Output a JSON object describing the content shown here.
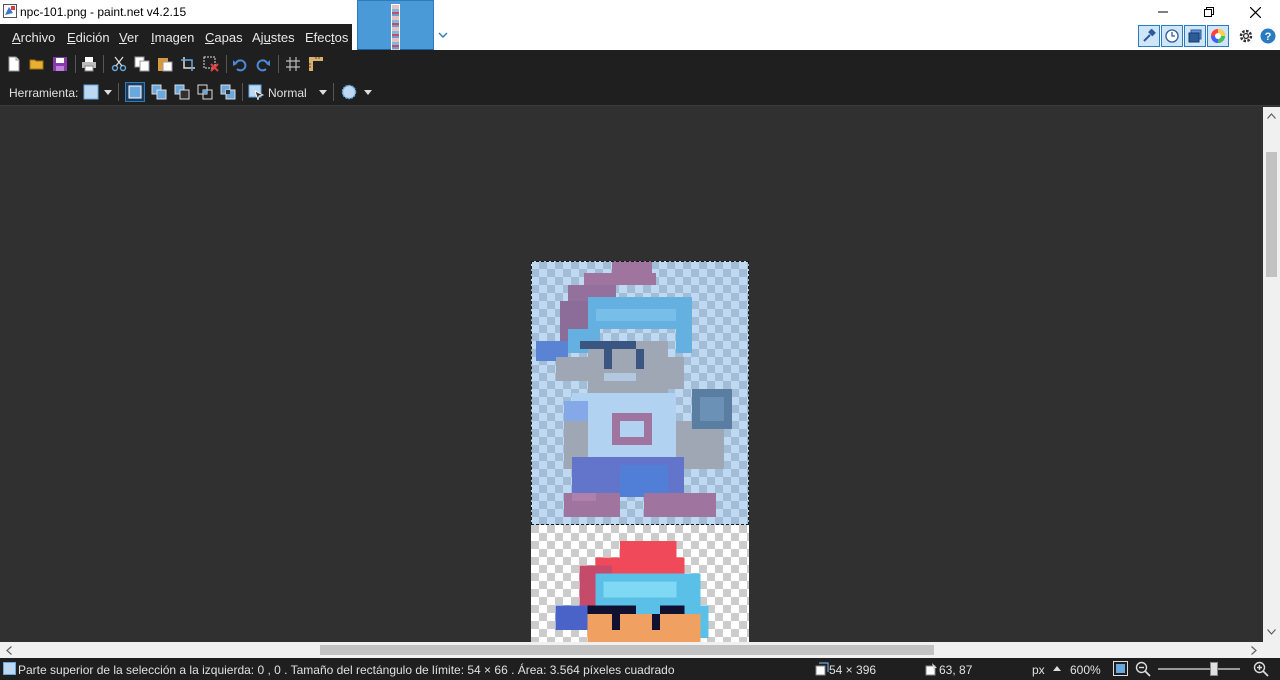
{
  "window": {
    "title": "npc-101.png - paint.net v4.2.15"
  },
  "menu": {
    "items": [
      {
        "prefix": "",
        "underline": "A",
        "rest": "rchivo"
      },
      {
        "prefix": "",
        "underline": "E",
        "rest": "dición"
      },
      {
        "prefix": "",
        "underline": "V",
        "rest": "er"
      },
      {
        "prefix": "",
        "underline": "I",
        "rest": "magen"
      },
      {
        "prefix": "",
        "underline": "C",
        "rest": "apas"
      },
      {
        "prefix": "Aj",
        "underline": "u",
        "rest": "stes"
      },
      {
        "prefix": "Efec",
        "underline": "t",
        "rest": "os"
      }
    ]
  },
  "toolbar2": {
    "tool_label": "Herramienta:",
    "blend_mode": "Normal"
  },
  "status": {
    "selection_info": "Parte superior de la selección a la izquierda: 0 , 0 . Tamaño del rectángulo de límite: 54  × 66 . Área: 3.564 píxeles cuadrado",
    "image_size": "54 × 396",
    "cursor_pos": "63, 87",
    "units": "px",
    "zoom": "600%"
  },
  "colors": {
    "accent": "#2a7bc2",
    "dark_bar": "#1f1f1f",
    "workspace": "#303030"
  }
}
